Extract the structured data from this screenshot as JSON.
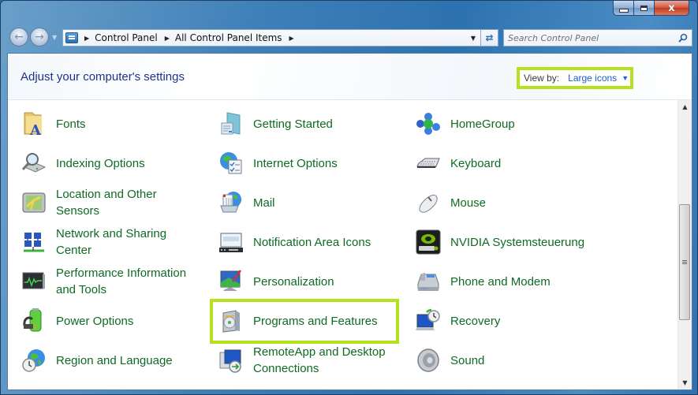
{
  "window": {
    "caption_buttons": {
      "minimize": "minimize",
      "maximize": "maximize",
      "close": "x"
    }
  },
  "nav": {
    "back_icon": "back-arrow-icon",
    "forward_icon": "forward-arrow-icon",
    "breadcrumb": [
      "Control Panel",
      "All Control Panel Items"
    ],
    "search_placeholder": "Search Control Panel"
  },
  "header": {
    "title": "Adjust your computer's settings",
    "view_by_label": "View by:",
    "view_by_value": "Large icons"
  },
  "highlight_color": "#b5e21b",
  "link_color": "#0f6a24",
  "columns": [
    {
      "items": [
        {
          "label": "Fonts",
          "icon": "fonts-folder-icon"
        },
        {
          "label": "Indexing Options",
          "icon": "indexing-magnifier-icon"
        },
        {
          "label": "Location and Other Sensors",
          "icon": "location-sensor-icon"
        },
        {
          "label": "Network and Sharing Center",
          "icon": "network-icon"
        },
        {
          "label": "Performance Information and Tools",
          "icon": "performance-monitor-icon"
        },
        {
          "label": "Power Options",
          "icon": "battery-plug-icon"
        },
        {
          "label": "Region and Language",
          "icon": "globe-clock-icon"
        }
      ]
    },
    {
      "items": [
        {
          "label": "Getting Started",
          "icon": "getting-started-icon"
        },
        {
          "label": "Internet Options",
          "icon": "internet-options-icon"
        },
        {
          "label": "Mail",
          "icon": "mail-icon"
        },
        {
          "label": "Notification Area Icons",
          "icon": "notification-area-icon"
        },
        {
          "label": "Personalization",
          "icon": "personalization-icon"
        },
        {
          "label": "Programs and Features",
          "icon": "programs-features-icon"
        },
        {
          "label": "RemoteApp and Desktop Connections",
          "icon": "remoteapp-icon"
        }
      ]
    },
    {
      "items": [
        {
          "label": "HomeGroup",
          "icon": "homegroup-icon"
        },
        {
          "label": "Keyboard",
          "icon": "keyboard-icon"
        },
        {
          "label": "Mouse",
          "icon": "mouse-icon"
        },
        {
          "label": "NVIDIA Systemsteuerung",
          "icon": "nvidia-icon"
        },
        {
          "label": "Phone and Modem",
          "icon": "phone-modem-icon"
        },
        {
          "label": "Recovery",
          "icon": "recovery-icon"
        },
        {
          "label": "Sound",
          "icon": "speaker-icon"
        }
      ]
    }
  ]
}
